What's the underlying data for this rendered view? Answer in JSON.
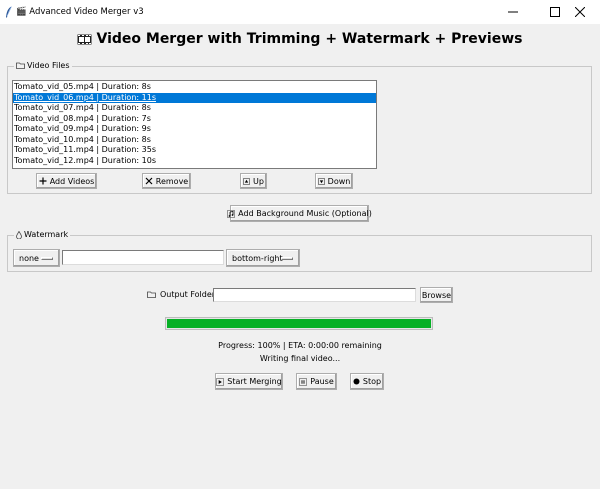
{
  "window": {
    "title": "🎬 Advanced Video Merger v3"
  },
  "heading": "Video Merger with Trimming + Watermark + Previews",
  "video_files": {
    "legend": "Video Files",
    "items": [
      "Tomato_vid_05.mp4 | Duration: 8s",
      "Tomato_vid_06.mp4 | Duration: 11s",
      "Tomato_vid_07.mp4 | Duration: 8s",
      "Tomato_vid_08.mp4 | Duration: 7s",
      "Tomato_vid_09.mp4 | Duration: 9s",
      "Tomato_vid_10.mp4 | Duration: 8s",
      "Tomato_vid_11.mp4 | Duration: 35s",
      "Tomato_vid_12.mp4 | Duration: 10s"
    ],
    "selected_index": 1,
    "buttons": {
      "add": "Add Videos",
      "remove": "Remove",
      "up": "Up",
      "down": "Down"
    }
  },
  "music_button": "Add Background Music (Optional)",
  "watermark": {
    "legend": "Watermark",
    "mode": "none",
    "text": "",
    "position": "bottom-right"
  },
  "output": {
    "label": "Output Folder",
    "path": "",
    "browse": "Browse"
  },
  "progress": {
    "fraction": 1.0,
    "status": "Progress: 100% | ETA: 0:00:00 remaining",
    "message": "Writing final video..."
  },
  "controls": {
    "start": "Start Merging",
    "pause": "Pause",
    "stop": "Stop"
  },
  "colors": {
    "selection": "#0078d7",
    "progress": "#06b025"
  }
}
